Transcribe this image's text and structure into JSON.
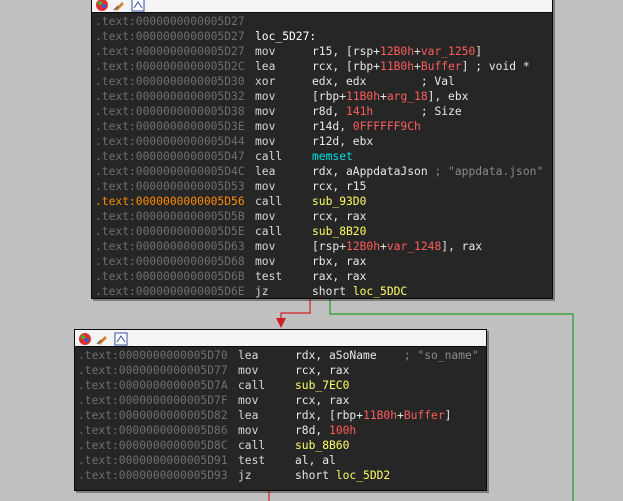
{
  "node1": {
    "lines": [
      {
        "addr": ".text:0000000000005D27",
        "mn": "",
        "op": [],
        "hl": false
      },
      {
        "addr": ".text:0000000000005D27",
        "mn": "",
        "op": [
          {
            "t": "loc_5D27:",
            "c": "lbl"
          }
        ],
        "hl": false,
        "label": true
      },
      {
        "addr": ".text:0000000000005D27",
        "mn": "mov",
        "op": [
          {
            "t": "r15, [rsp+",
            "c": "wht"
          },
          {
            "t": "12B0h",
            "c": "red"
          },
          {
            "t": "+",
            "c": "wht"
          },
          {
            "t": "var_1250",
            "c": "red"
          },
          {
            "t": "]",
            "c": "wht"
          }
        ],
        "hl": false
      },
      {
        "addr": ".text:0000000000005D2C",
        "mn": "lea",
        "op": [
          {
            "t": "rcx, [rbp+",
            "c": "wht"
          },
          {
            "t": "11B0h",
            "c": "red"
          },
          {
            "t": "+",
            "c": "wht"
          },
          {
            "t": "Buffer",
            "c": "red"
          },
          {
            "t": "] ; void *",
            "c": "wht"
          }
        ],
        "hl": false
      },
      {
        "addr": ".text:0000000000005D30",
        "mn": "xor",
        "op": [
          {
            "t": "edx, edx        ; Val",
            "c": "wht"
          }
        ],
        "hl": false
      },
      {
        "addr": ".text:0000000000005D32",
        "mn": "mov",
        "op": [
          {
            "t": "[rbp+",
            "c": "wht"
          },
          {
            "t": "11B0h",
            "c": "red"
          },
          {
            "t": "+",
            "c": "wht"
          },
          {
            "t": "arg_18",
            "c": "red"
          },
          {
            "t": "], ebx",
            "c": "wht"
          }
        ],
        "hl": false
      },
      {
        "addr": ".text:0000000000005D38",
        "mn": "mov",
        "op": [
          {
            "t": "r8d, ",
            "c": "wht"
          },
          {
            "t": "141h",
            "c": "red"
          },
          {
            "t": "       ; Size",
            "c": "wht"
          }
        ],
        "hl": false
      },
      {
        "addr": ".text:0000000000005D3E",
        "mn": "mov",
        "op": [
          {
            "t": "r14d, ",
            "c": "wht"
          },
          {
            "t": "0FFFFFF9Ch",
            "c": "red"
          }
        ],
        "hl": false
      },
      {
        "addr": ".text:0000000000005D44",
        "mn": "mov",
        "op": [
          {
            "t": "r12d, ebx",
            "c": "wht"
          }
        ],
        "hl": false
      },
      {
        "addr": ".text:0000000000005D47",
        "mn": "call",
        "op": [
          {
            "t": "memset",
            "c": "cyan"
          }
        ],
        "hl": false
      },
      {
        "addr": ".text:0000000000005D4C",
        "mn": "lea",
        "op": [
          {
            "t": "rdx, aAppdataJson ",
            "c": "wht"
          },
          {
            "t": "; \"appdata.json\"",
            "c": "gray"
          }
        ],
        "hl": false
      },
      {
        "addr": ".text:0000000000005D53",
        "mn": "mov",
        "op": [
          {
            "t": "rcx, r15",
            "c": "wht"
          }
        ],
        "hl": false
      },
      {
        "addr": ".text:0000000000005D56",
        "mn": "call",
        "op": [
          {
            "t": "sub_93D0",
            "c": "yel"
          }
        ],
        "hl": true
      },
      {
        "addr": ".text:0000000000005D5B",
        "mn": "mov",
        "op": [
          {
            "t": "rcx, rax",
            "c": "wht"
          }
        ],
        "hl": false
      },
      {
        "addr": ".text:0000000000005D5E",
        "mn": "call",
        "op": [
          {
            "t": "sub_8B20",
            "c": "yel"
          }
        ],
        "hl": false
      },
      {
        "addr": ".text:0000000000005D63",
        "mn": "mov",
        "op": [
          {
            "t": "[rsp+",
            "c": "wht"
          },
          {
            "t": "12B0h",
            "c": "red"
          },
          {
            "t": "+",
            "c": "wht"
          },
          {
            "t": "var_1248",
            "c": "red"
          },
          {
            "t": "], rax",
            "c": "wht"
          }
        ],
        "hl": false
      },
      {
        "addr": ".text:0000000000005D68",
        "mn": "mov",
        "op": [
          {
            "t": "rbx, rax",
            "c": "wht"
          }
        ],
        "hl": false
      },
      {
        "addr": ".text:0000000000005D6B",
        "mn": "test",
        "op": [
          {
            "t": "rax, rax",
            "c": "wht"
          }
        ],
        "hl": false
      },
      {
        "addr": ".text:0000000000005D6E",
        "mn": "jz",
        "op": [
          {
            "t": "short ",
            "c": "wht"
          },
          {
            "t": "loc_5DDC",
            "c": "yel"
          }
        ],
        "hl": false
      }
    ]
  },
  "node2": {
    "lines": [
      {
        "addr": ".text:0000000000005D70",
        "mn": "lea",
        "op": [
          {
            "t": "rdx, aSoName    ",
            "c": "wht"
          },
          {
            "t": "; \"so_name\"",
            "c": "gray"
          }
        ],
        "hl": false
      },
      {
        "addr": ".text:0000000000005D77",
        "mn": "mov",
        "op": [
          {
            "t": "rcx, rax",
            "c": "wht"
          }
        ],
        "hl": false
      },
      {
        "addr": ".text:0000000000005D7A",
        "mn": "call",
        "op": [
          {
            "t": "sub_7EC0",
            "c": "yel"
          }
        ],
        "hl": false
      },
      {
        "addr": ".text:0000000000005D7F",
        "mn": "mov",
        "op": [
          {
            "t": "rcx, rax",
            "c": "wht"
          }
        ],
        "hl": false
      },
      {
        "addr": ".text:0000000000005D82",
        "mn": "lea",
        "op": [
          {
            "t": "rdx, [rbp+",
            "c": "wht"
          },
          {
            "t": "11B0h",
            "c": "red"
          },
          {
            "t": "+",
            "c": "wht"
          },
          {
            "t": "Buffer",
            "c": "red"
          },
          {
            "t": "]",
            "c": "wht"
          }
        ],
        "hl": false
      },
      {
        "addr": ".text:0000000000005D86",
        "mn": "mov",
        "op": [
          {
            "t": "r8d, ",
            "c": "wht"
          },
          {
            "t": "100h",
            "c": "red"
          }
        ],
        "hl": false
      },
      {
        "addr": ".text:0000000000005D8C",
        "mn": "call",
        "op": [
          {
            "t": "sub_8B60",
            "c": "yel"
          }
        ],
        "hl": false
      },
      {
        "addr": ".text:0000000000005D91",
        "mn": "test",
        "op": [
          {
            "t": "al, al",
            "c": "wht"
          }
        ],
        "hl": false
      },
      {
        "addr": ".text:0000000000005D93",
        "mn": "jz",
        "op": [
          {
            "t": "short ",
            "c": "wht"
          },
          {
            "t": "loc_5DD2",
            "c": "yel"
          }
        ],
        "hl": false
      }
    ]
  },
  "header_icons": [
    "color-palette-icon",
    "edit-node-icon",
    "graph-node-icon"
  ],
  "colors": {
    "background": "#c0c0c0",
    "node_bg": "#262626",
    "edge_false": "#d02020",
    "edge_true": "#20a020"
  }
}
